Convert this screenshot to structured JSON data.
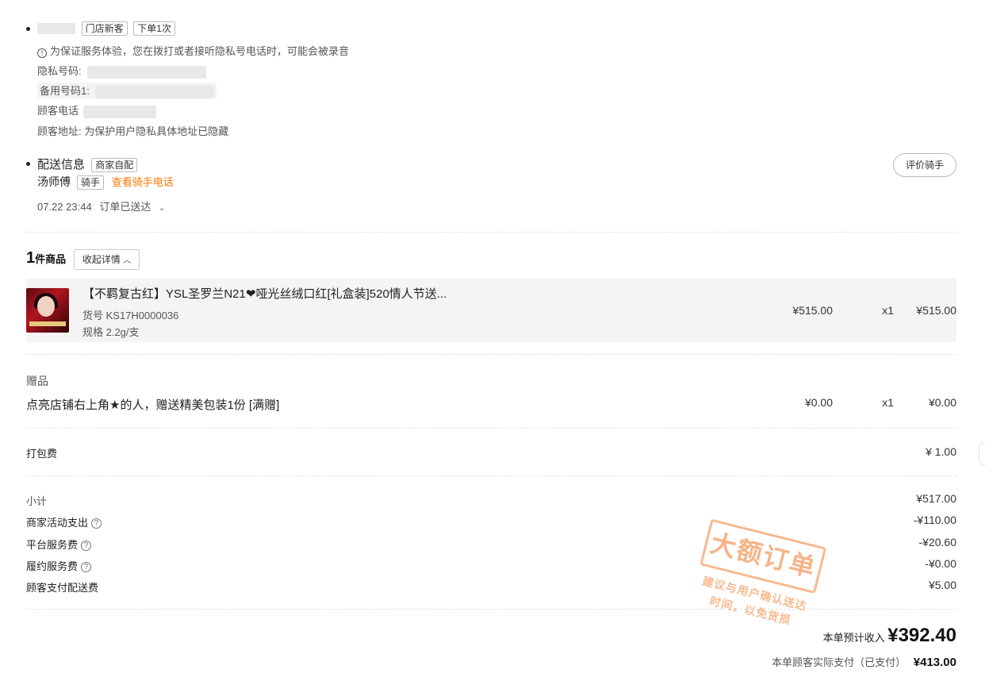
{
  "customer": {
    "tags": [
      "门店新客",
      "下单1次"
    ],
    "notice": "为保证服务体验，您在拨打或者接听隐私号电话时，可能会被录音",
    "privacy_label": "隐私号码:",
    "backup_label": "备用号码1:",
    "phone_label": "顾客电话",
    "address_label": "顾客地址:",
    "address_value": "为保护用户隐私具体地址已隐藏"
  },
  "delivery": {
    "title": "配送信息",
    "mode_tag": "商家自配",
    "rider_name": "汤师傅",
    "rider_tag": "骑手",
    "view_phone": "查看骑手电话",
    "rate_button": "评价骑手",
    "status_time": "07.22 23:44",
    "status_text": "订单已送达"
  },
  "goods": {
    "count": "1",
    "count_suffix": "件商品",
    "collapse_button": "收起详情",
    "items": [
      {
        "name": "【不羁复古红】YSL圣罗兰N21❤哑光丝绒口红[礼盒装]520情人节送...",
        "sku": "货号 KS17H0000036",
        "spec": "规格 2.2g/支",
        "price": "¥515.00",
        "qty": "x1",
        "total": "¥515.00"
      }
    ]
  },
  "gift": {
    "title": "赠品",
    "name": "点亮店铺右上角★的人，赠送精美包装1份 [满赠]",
    "price": "¥0.00",
    "qty": "x1",
    "total": "¥0.00"
  },
  "packing": {
    "label": "打包费",
    "value": "¥ 1.00"
  },
  "summary": {
    "rows": [
      {
        "label": "小计",
        "value": "¥517.00",
        "help": false
      },
      {
        "label": "商家活动支出",
        "value": "-¥110.00",
        "help": true
      },
      {
        "label": "平台服务费",
        "value": "-¥20.60",
        "help": true
      },
      {
        "label": "履约服务费",
        "value": "-¥0.00",
        "help": true
      },
      {
        "label": "顾客支付配送费",
        "value": "¥5.00",
        "help": false
      }
    ],
    "income_label": "本单预计收入",
    "income_value": "¥392.40",
    "paid_label": "本单顾客实际支付（已支付）",
    "paid_value": "¥413.00"
  },
  "stamp": {
    "title": "大额订单",
    "line1": "建议与用户确认送达",
    "line2": "时间，以免货损"
  },
  "colors": {
    "accent": "#ff7700",
    "stamp": "#f5a26a"
  }
}
